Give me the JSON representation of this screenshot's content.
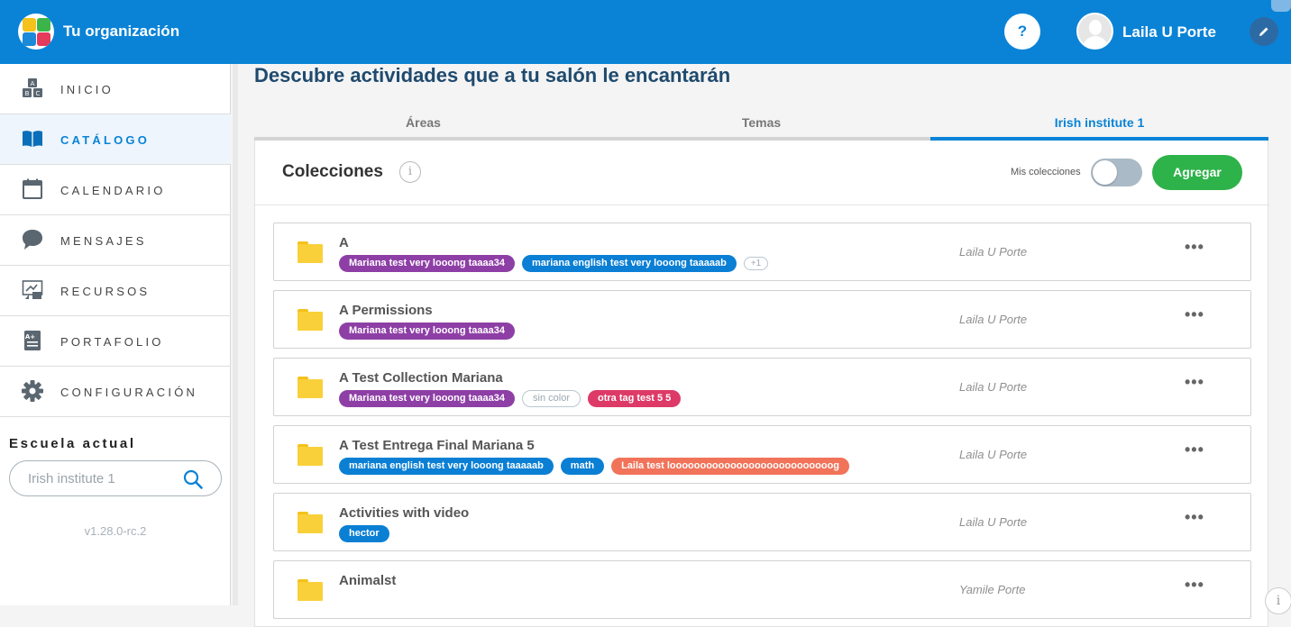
{
  "header": {
    "org_name": "Tu organización",
    "help_label": "?",
    "user_name": "Laila U Porte"
  },
  "sidebar": {
    "items": [
      {
        "label": "INICIO",
        "icon": "abc-blocks-icon"
      },
      {
        "label": "CATÁLOGO",
        "icon": "book-icon",
        "active": true
      },
      {
        "label": "CALENDARIO",
        "icon": "calendar-icon"
      },
      {
        "label": "MENSAJES",
        "icon": "chat-bubble-icon"
      },
      {
        "label": "RECURSOS",
        "icon": "resources-icon"
      },
      {
        "label": "PORTAFOLIO",
        "icon": "portfolio-icon"
      },
      {
        "label": "CONFIGURACIÓN",
        "icon": "gear-icon"
      }
    ],
    "school_label": "Escuela actual",
    "school_value": "Irish institute 1",
    "version": "v1.28.0-rc.2"
  },
  "main": {
    "title": "Descubre actividades que a tu salón le encantarán",
    "tabs": [
      {
        "label": "Áreas"
      },
      {
        "label": "Temas"
      },
      {
        "label": "Irish institute 1",
        "active": true
      }
    ],
    "collections": {
      "title": "Colecciones",
      "info_label": "i",
      "my_collections_label": "Mis colecciones",
      "my_collections_on": false,
      "add_label": "Agregar",
      "rows": [
        {
          "name": "A",
          "owner": "Laila U Porte",
          "tags": [
            {
              "text": "Mariana test very looong taaaa34",
              "color": "#8e3fa6"
            },
            {
              "text": "mariana english test very looong taaaaab",
              "color": "#0a7fd4"
            },
            {
              "text": "+1",
              "style": "count"
            }
          ]
        },
        {
          "name": "A Permissions",
          "owner": "Laila U Porte",
          "tags": [
            {
              "text": "Mariana test very looong taaaa34",
              "color": "#8e3fa6"
            }
          ]
        },
        {
          "name": "A Test Collection Mariana",
          "owner": "Laila U Porte",
          "tags": [
            {
              "text": "Mariana test very looong taaaa34",
              "color": "#8e3fa6"
            },
            {
              "text": "sin color",
              "style": "outline"
            },
            {
              "text": "otra tag test 5 5",
              "color": "#dd3a68"
            }
          ]
        },
        {
          "name": "A Test Entrega Final Mariana 5",
          "owner": "Laila U Porte",
          "tags": [
            {
              "text": "mariana english test very looong taaaaab",
              "color": "#0a7fd4"
            },
            {
              "text": "math",
              "color": "#0a7fd4"
            },
            {
              "text": "Laila test looooooooooooooooooooooooooog",
              "color": "#f0735a"
            }
          ]
        },
        {
          "name": "Activities with video",
          "owner": "Laila U Porte",
          "tags": [
            {
              "text": "hector",
              "color": "#0a7fd4"
            }
          ]
        },
        {
          "name": "Animalst",
          "owner": "Yamile Porte",
          "tags": []
        }
      ]
    }
  },
  "colors": {
    "header_bg": "#0a83d6",
    "accent": "#0a83d6",
    "add_button": "#2eb24a"
  }
}
